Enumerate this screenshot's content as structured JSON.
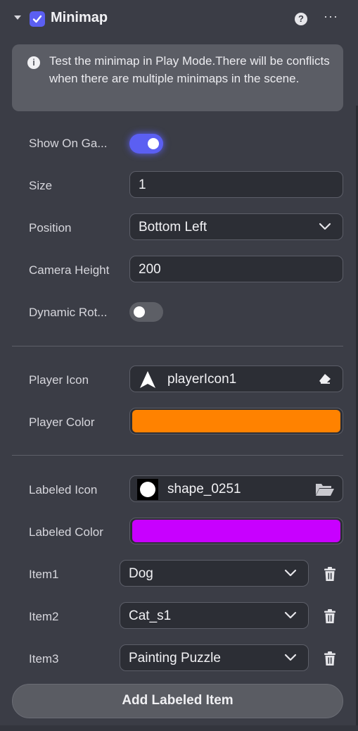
{
  "header": {
    "title": "Minimap",
    "help_symbol": "?",
    "more_symbol": "···",
    "enabled": true
  },
  "info": {
    "text": "Test the minimap in Play Mode.There will be conflicts when there are multiple minimaps in the scene."
  },
  "fields": {
    "show_on_game": {
      "label": "Show On Ga...",
      "on": true
    },
    "size": {
      "label": "Size",
      "value": "1"
    },
    "position": {
      "label": "Position",
      "value": "Bottom Left"
    },
    "camera_height": {
      "label": "Camera Height",
      "value": "200"
    },
    "dynamic_rotation": {
      "label": "Dynamic Rot...",
      "on": false
    },
    "player_icon": {
      "label": "Player Icon",
      "value": "playerIcon1",
      "icon": "arrow-up-icon"
    },
    "player_color": {
      "label": "Player Color",
      "color": "#ff8200"
    },
    "labeled_icon": {
      "label": "Labeled Icon",
      "value": "shape_0251",
      "icon": "circle-shape-icon"
    },
    "labeled_color": {
      "label": "Labeled Color",
      "color": "#c800ff"
    }
  },
  "items": [
    {
      "label": "Item1",
      "value": "Dog"
    },
    {
      "label": "Item2",
      "value": "Cat_s1"
    },
    {
      "label": "Item3",
      "value": "Painting Puzzle"
    }
  ],
  "add_button": {
    "label": "Add Labeled Item"
  },
  "colors": {
    "accent": "#5b5ff2",
    "panel": "#3b3d46",
    "field": "#2c2e35"
  }
}
